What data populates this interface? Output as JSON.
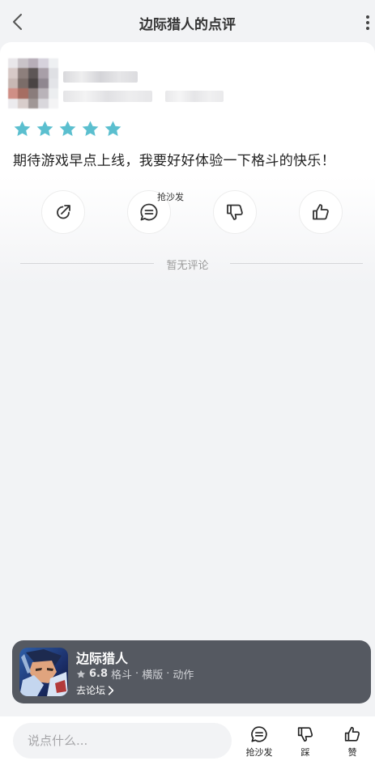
{
  "header": {
    "title": "边际猎人的点评"
  },
  "review": {
    "rating": 5,
    "rating_max": 5,
    "star_color": "#5bbfcf",
    "text": "期待游戏早点上线，我要好好体验一下格斗的快乐！",
    "sofa_tag": "抢沙发"
  },
  "comments": {
    "empty_text": "暂无评论"
  },
  "game": {
    "name": "边际猎人",
    "score": "6.8",
    "tags": [
      "格斗",
      "横版",
      "动作"
    ],
    "separator": "·",
    "forum_link": "去论坛"
  },
  "bottom_bar": {
    "input_placeholder": "说点什么...",
    "sofa_label": "抢沙发",
    "dislike_label": "踩",
    "like_label": "赞"
  },
  "colors": {
    "background": "#f2f3f5",
    "card_dark": "#555961",
    "accent_star": "#5bbfcf"
  }
}
